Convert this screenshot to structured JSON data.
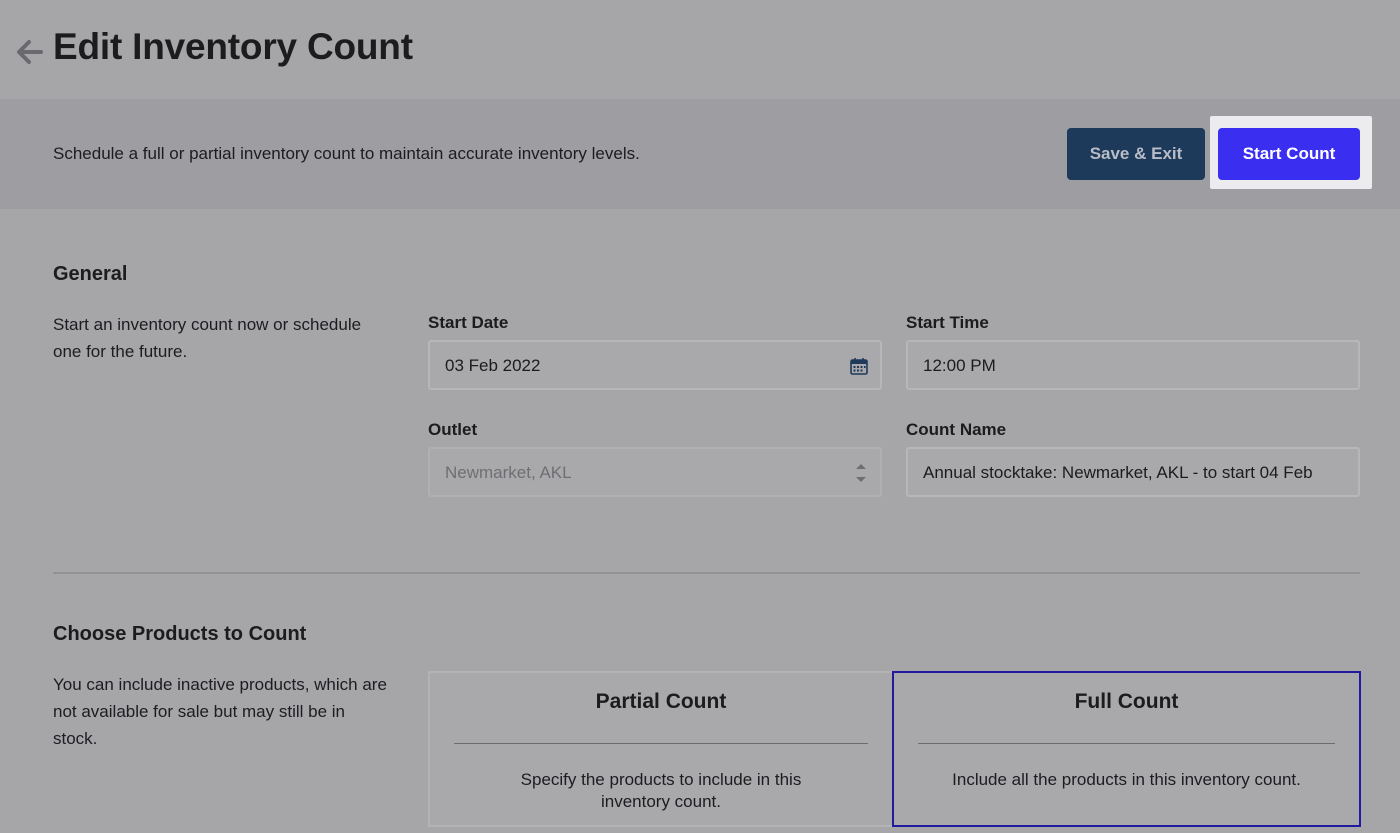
{
  "header": {
    "title": "Edit Inventory Count"
  },
  "toolbar": {
    "description": "Schedule a full or partial inventory count to maintain accurate inventory levels.",
    "save_label": "Save & Exit",
    "start_label": "Start Count"
  },
  "general": {
    "title": "General",
    "description": "Start an inventory count now or schedule one for the future.",
    "start_date": {
      "label": "Start Date",
      "value": "03 Feb 2022"
    },
    "start_time": {
      "label": "Start Time",
      "value": "12:00 PM"
    },
    "outlet": {
      "label": "Outlet",
      "value": "Newmarket, AKL"
    },
    "count_name": {
      "label": "Count Name",
      "value": "Annual stocktake: Newmarket, AKL - to start 04 Feb"
    }
  },
  "products": {
    "title": "Choose Products to Count",
    "description": "You can include inactive products, which are not available for sale but may still be in stock.",
    "options": [
      {
        "title": "Partial Count",
        "description": "Specify the products to include in this inventory count.",
        "selected": false
      },
      {
        "title": "Full Count",
        "description": "Include all the products in this inventory count.",
        "selected": true
      }
    ]
  },
  "colors": {
    "primary": "#3a2ff0",
    "secondary": "#1d3a5a",
    "selected_border": "#1f1a9e"
  },
  "icons": {
    "back": "arrow-left-icon",
    "date": "calendar-icon",
    "select": "stepper-icon"
  }
}
